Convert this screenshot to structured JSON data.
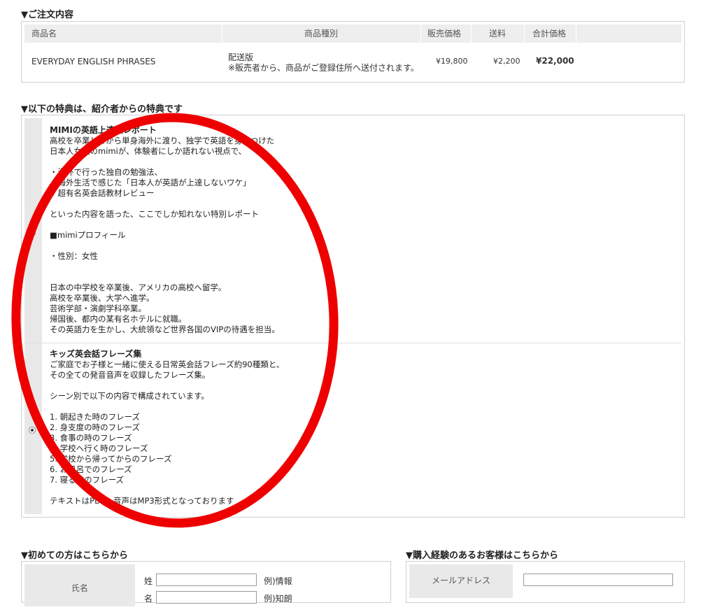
{
  "order": {
    "title": "▼ご注文内容",
    "headers": {
      "name": "商品名",
      "type": "商品種別",
      "price": "販売価格",
      "shipping": "送料",
      "total": "合計価格"
    },
    "row": {
      "name": "EVERYDAY ENGLISH PHRASES",
      "type_line1": "配送版",
      "type_line2": "※販売者から、商品がご登録住所へ送付されます。",
      "price": "¥19,800",
      "shipping": "¥2,200",
      "total": "¥22,000"
    }
  },
  "benefits": {
    "title": "▼以下の特典は、紹介者からの特典です",
    "items": [
      {
        "title": "MIMIの英語上達法レポート",
        "body": "高校を卒業してから単身海外に渡り、独学で英語を身につけた\n日本人女性のmimiが、体験者にしか語れない視点で、\n\n・海外で行った独自の勉強法、\n・海外生活で感じた「日本人が英語が上達しないワケ」\n・超有名英会話教材レビュー\n\nといった内容を語った、ここでしか知れない特別レポート\n\n■mimiプロフィール\n\n・性別：女性\n\n\n日本の中学校を卒業後、アメリカの高校へ留学。\n高校を卒業後、大学へ進学。\n芸術学部・演劇学科卒業。\n帰国後、都内の某有名ホテルに就職。\nその英語力を生かし、大統領など世界各国のVIPの待遇を担当。",
        "selected": false
      },
      {
        "title": "キッズ英会話フレーズ集",
        "body": "ご家庭でお子様と一緒に使える日常英会話フレーズ約90種類と、\nその全ての発音音声を収録したフレーズ集。\n\nシーン別で以下の内容で構成されています。\n\n1. 朝起きた時のフレーズ\n2. 身支度の時のフレーズ\n3. 食事の時のフレーズ\n4. 学校へ行く時のフレーズ\n5. 学校から帰ってからのフレーズ\n6. お風呂でのフレーズ\n7. 寝る時のフレーズ\n\nテキストはPDF、音声はMP3形式となっております",
        "selected": true
      }
    ]
  },
  "new_customer": {
    "title": "▼初めての方はこちらから",
    "name_label": "氏名",
    "last_name_label": "姓",
    "last_name_value": "",
    "last_name_example": "例)情報",
    "first_name_label": "名",
    "first_name_value": "",
    "first_name_example": "例)知朗"
  },
  "returning_customer": {
    "title": "▼購入経験のあるお客様はこちらから",
    "email_label": "メールアドレス",
    "email_value": ""
  },
  "annotation": {
    "color": "#ee0000",
    "shape": "ellipse"
  }
}
